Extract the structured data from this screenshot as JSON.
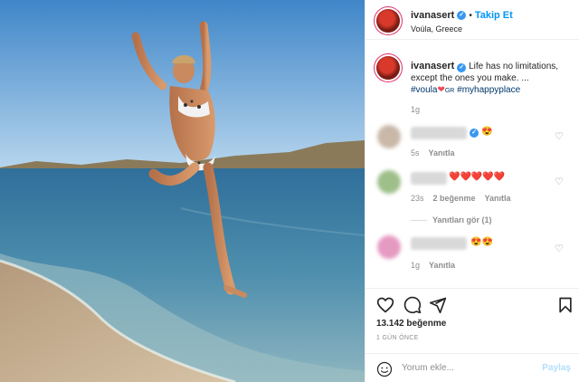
{
  "post": {
    "username": "ivanasert",
    "follow_label": "Takip Et",
    "location": "Voúla, Greece",
    "caption": {
      "text": "Life has no limitations, except the ones you make. ...",
      "tag1": "#voula",
      "flag": "GR",
      "tag2": "#myhappyplace",
      "time": "1g"
    },
    "likes": "13.142 beğenme",
    "date": "1 GÜN ÖNCE"
  },
  "comments": [
    {
      "emoji": "😍",
      "time": "5s",
      "reply": "Yanıtla"
    },
    {
      "emoji": "❤️❤️❤️❤️❤️",
      "time": "23s",
      "likes": "2 beğenme",
      "reply": "Yanıtla",
      "view_replies": "Yanıtları gör (1)"
    },
    {
      "emoji": "😍😍",
      "time": "1g",
      "reply": "Yanıtla"
    }
  ],
  "composer": {
    "placeholder": "Yorum ekle...",
    "post_label": "Paylaş"
  },
  "colors": {
    "accent": "#0095f6",
    "verified": "#3897f0",
    "muted": "#8e8e8e",
    "heart": "#ed4956"
  },
  "icons": [
    "heart-icon",
    "comment-icon",
    "share-icon",
    "bookmark-icon",
    "emoji-icon",
    "verified-icon"
  ]
}
